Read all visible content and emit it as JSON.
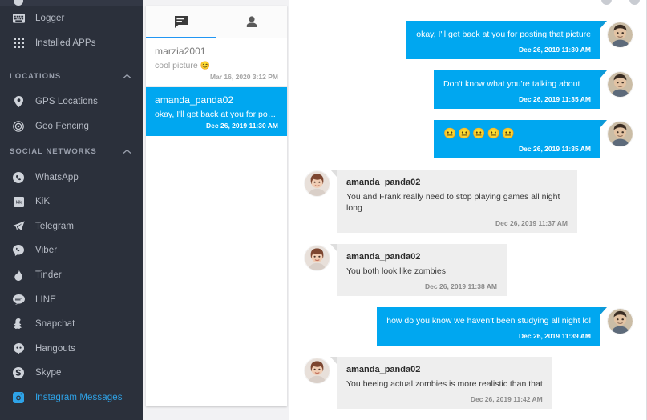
{
  "colors": {
    "sidebar_bg": "#2b303b",
    "accent_blue": "#00a7f0",
    "tab_indicator": "#2196f3",
    "active_nav": "#2ea3e8",
    "incoming_bubble": "#eeeeee"
  },
  "sidebar": {
    "items": [
      {
        "label": "Logger",
        "icon": "keyboard-icon",
        "type": "item",
        "active": false
      },
      {
        "label": "Installed APPs",
        "icon": "grid-apps-icon",
        "type": "item",
        "active": false
      }
    ],
    "sections": [
      {
        "title": "LOCATIONS",
        "chevron": "chevron-up-icon",
        "items": [
          {
            "label": "GPS Locations",
            "icon": "map-pin-icon",
            "active": false
          },
          {
            "label": "Geo Fencing",
            "icon": "target-icon",
            "active": false
          }
        ]
      },
      {
        "title": "SOCIAL NETWORKS",
        "chevron": "chevron-up-icon",
        "items": [
          {
            "label": "WhatsApp",
            "icon": "whatsapp-icon",
            "active": false
          },
          {
            "label": "KiK",
            "icon": "kik-icon",
            "active": false
          },
          {
            "label": "Telegram",
            "icon": "telegram-icon",
            "active": false
          },
          {
            "label": "Viber",
            "icon": "viber-icon",
            "active": false
          },
          {
            "label": "Tinder",
            "icon": "tinder-flame-icon",
            "active": false
          },
          {
            "label": "LINE",
            "icon": "line-icon",
            "active": false
          },
          {
            "label": "Snapchat",
            "icon": "snapchat-ghost-icon",
            "active": false
          },
          {
            "label": "Hangouts",
            "icon": "hangouts-icon",
            "active": false
          },
          {
            "label": "Skype",
            "icon": "skype-icon",
            "active": false
          },
          {
            "label": "Instagram Messages",
            "icon": "instagram-icon",
            "active": true
          }
        ]
      }
    ]
  },
  "conversation_panel": {
    "tabs": [
      {
        "icon": "chat-bubble-icon",
        "name": "messages-tab",
        "active": true
      },
      {
        "icon": "person-icon",
        "name": "contacts-tab",
        "active": false
      }
    ],
    "conversations": [
      {
        "name": "marzia2001",
        "preview": "cool picture",
        "preview_emoji": "😊",
        "time": "Mar 16, 2020 3:12 PM",
        "selected": false
      },
      {
        "name": "amanda_panda02",
        "preview": "okay, I'll get back at you for posting tha...",
        "preview_emoji": "",
        "time": "Dec 26, 2019 11:30 AM",
        "selected": true
      }
    ]
  },
  "chat": {
    "messages": [
      {
        "direction": "out",
        "sender": "",
        "text": "okay, I'll get back at you for posting that picture",
        "time": "Dec 26, 2019 11:30 AM",
        "avatar": "male-avatar",
        "is_emoji": false
      },
      {
        "direction": "out",
        "sender": "",
        "text": "Don't know what you're talking about",
        "time": "Dec 26, 2019 11:35 AM",
        "avatar": "male-avatar",
        "is_emoji": false
      },
      {
        "direction": "out",
        "sender": "",
        "text": "😐😐😐😐😐",
        "time": "Dec 26, 2019 11:35 AM",
        "avatar": "male-avatar",
        "is_emoji": true
      },
      {
        "direction": "in",
        "sender": "amanda_panda02",
        "text": "You and Frank really need to stop playing games all night long",
        "time": "Dec 26, 2019 11:37 AM",
        "avatar": "female-avatar",
        "is_emoji": false
      },
      {
        "direction": "in",
        "sender": "amanda_panda02",
        "text": "You both look like zombies",
        "time": "Dec 26, 2019 11:38 AM",
        "avatar": "female-avatar",
        "is_emoji": false
      },
      {
        "direction": "out",
        "sender": "",
        "text": "how do you know we haven't been studying all night lol",
        "time": "Dec 26, 2019 11:39 AM",
        "avatar": "male-avatar",
        "is_emoji": false
      },
      {
        "direction": "in",
        "sender": "amanda_panda02",
        "text": "You beeing actual zombies is more realistic than that",
        "time": "Dec 26, 2019 11:42 AM",
        "avatar": "female-avatar",
        "is_emoji": false
      }
    ]
  }
}
